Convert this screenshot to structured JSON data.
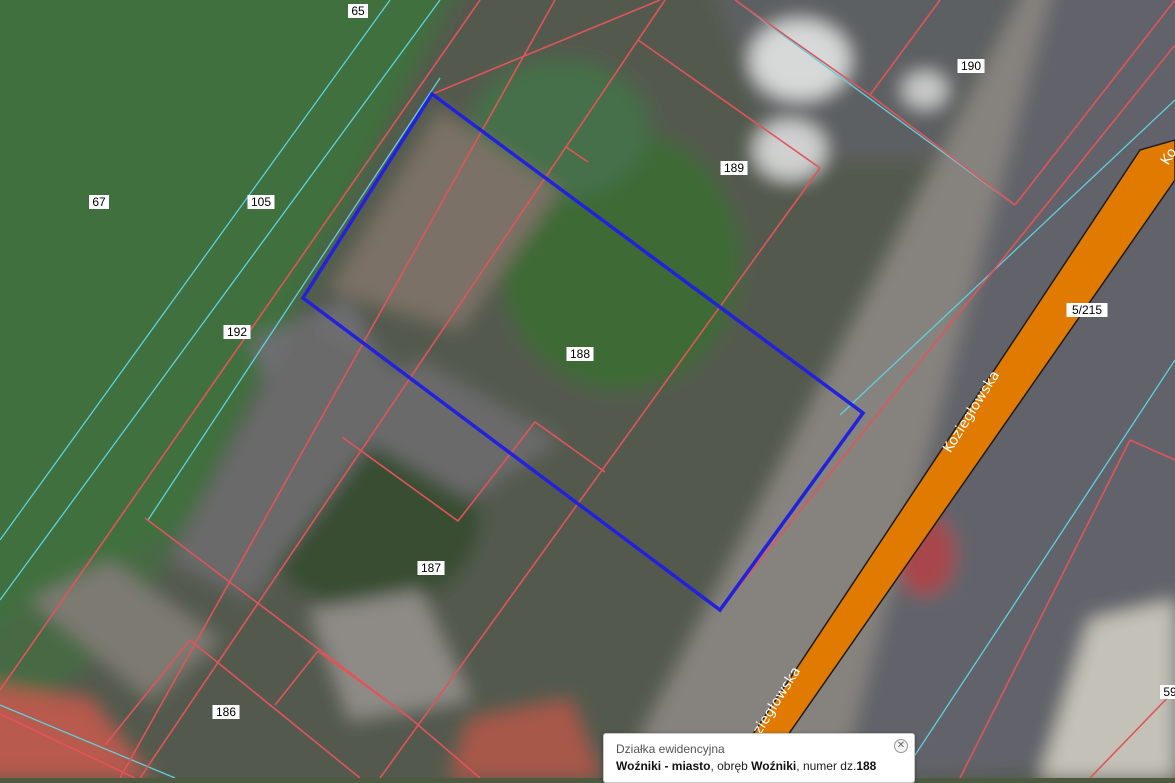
{
  "map": {
    "parcel_numbers": [
      "65",
      "190",
      "67",
      "105",
      "189",
      "192",
      "188",
      "187",
      "186",
      "5/215",
      "59"
    ],
    "street_name": "Koziegłowska",
    "street_name_fragment": "Ko",
    "colors": {
      "parcel_boundary": "#e0545a",
      "precinct_boundary": "#5ed0de",
      "selected_parcel": "#2222dd",
      "road": "#e07a00"
    }
  },
  "popup": {
    "title": "Działka ewidencyjna",
    "locality": "Woźniki - miasto",
    "sep1": ", obręb ",
    "precinct": "Woźniki",
    "sep2": ", numer dz.",
    "parcel_number": "188"
  }
}
